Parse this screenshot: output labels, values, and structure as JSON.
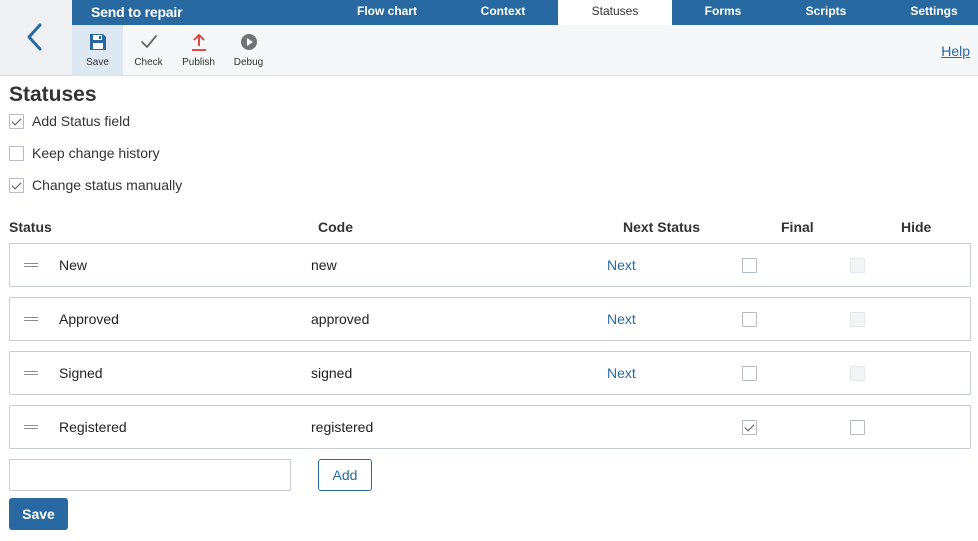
{
  "header": {
    "title": "Send to repair",
    "tabs": [
      {
        "label": "Flow chart",
        "active": false
      },
      {
        "label": "Context",
        "active": false
      },
      {
        "label": "Statuses",
        "active": true
      },
      {
        "label": "Forms",
        "active": false
      },
      {
        "label": "Scripts",
        "active": false
      },
      {
        "label": "Settings",
        "active": false
      }
    ],
    "back_icon": "chevron-left-icon"
  },
  "toolbar": {
    "save_label": "Save",
    "check_label": "Check",
    "publish_label": "Publish",
    "debug_label": "Debug",
    "help_label": "Help",
    "icons": {
      "save": "floppy-disk-icon",
      "check": "checkmark-icon",
      "publish": "upload-arrow-icon",
      "debug": "play-circle-icon"
    }
  },
  "main": {
    "title": "Statuses",
    "options": [
      {
        "label": "Add Status field",
        "checked": true
      },
      {
        "label": "Keep change history",
        "checked": false
      },
      {
        "label": "Change status manually",
        "checked": true
      }
    ],
    "columns": {
      "status": "Status",
      "code": "Code",
      "next_status": "Next Status",
      "final": "Final",
      "hide": "Hide"
    },
    "rows": [
      {
        "status": "New",
        "code": "new",
        "next": "Next",
        "final": false,
        "hide": false,
        "hide_disabled": true
      },
      {
        "status": "Approved",
        "code": "approved",
        "next": "Next",
        "final": false,
        "hide": false,
        "hide_disabled": true
      },
      {
        "status": "Signed",
        "code": "signed",
        "next": "Next",
        "final": false,
        "hide": false,
        "hide_disabled": true
      },
      {
        "status": "Registered",
        "code": "registered",
        "next": "",
        "final": true,
        "hide": false,
        "hide_disabled": false
      }
    ],
    "new_status_value": "",
    "add_label": "Add",
    "save_label": "Save"
  },
  "colors": {
    "brand": "#2769a0",
    "active_tool": "#dde8f2",
    "publish_icon": "#e0382f"
  }
}
